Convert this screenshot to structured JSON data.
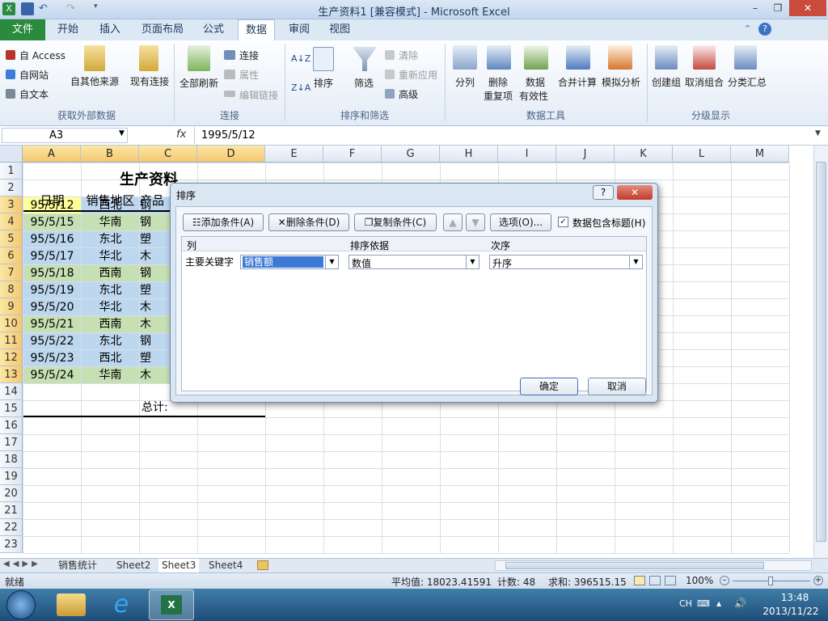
{
  "window": {
    "title": "生产资料1  [兼容模式] - Microsoft Excel",
    "minimize": "–",
    "restore": "❐",
    "close": "✕"
  },
  "tabs": [
    {
      "label": "文件"
    },
    {
      "label": "开始"
    },
    {
      "label": "插入"
    },
    {
      "label": "页面布局"
    },
    {
      "label": "公式"
    },
    {
      "label": "数据"
    },
    {
      "label": "审阅"
    },
    {
      "label": "视图"
    }
  ],
  "ribbon": {
    "ext": {
      "access": "自 Access",
      "web": "自网站",
      "text": "自文本",
      "other": "自其他来源",
      "existing": "现有连接",
      "group": "获取外部数据"
    },
    "conn": {
      "refresh_all": "全部刷新",
      "connections": "连接",
      "properties": "属性",
      "edit_links": "编辑链接",
      "group": "连接"
    },
    "sort": {
      "sort": "排序",
      "filter": "筛选",
      "clear": "清除",
      "reapply": "重新应用",
      "advanced": "高级",
      "group": "排序和筛选"
    },
    "tools": {
      "text_to_cols": "分列",
      "remove_dup_1": "删除",
      "remove_dup_2": "重复项",
      "validation_1": "数据",
      "validation_2": "有效性",
      "consolidate": "合并计算",
      "whatif": "模拟分析",
      "group": "数据工具"
    },
    "outline": {
      "group_btn": "创建组",
      "ungroup": "取消组合",
      "subtotal": "分类汇总",
      "group": "分级显示"
    }
  },
  "formula_bar": {
    "name_box": "A3",
    "fx": "fx",
    "value": "1995/5/12"
  },
  "columns": [
    "A",
    "B",
    "C",
    "D",
    "E",
    "F",
    "G",
    "H",
    "I",
    "J",
    "K",
    "L",
    "M"
  ],
  "rows": [
    "1",
    "2",
    "3",
    "4",
    "5",
    "6",
    "7",
    "8",
    "9",
    "10",
    "11",
    "12",
    "13",
    "14",
    "15",
    "16",
    "17",
    "18",
    "19",
    "20",
    "21",
    "22",
    "23"
  ],
  "sheet": {
    "title": "生产资料",
    "headers": [
      "日期",
      "销售地区",
      "产品"
    ],
    "data": [
      {
        "date": "95/5/12",
        "region": "西北",
        "product": "钢"
      },
      {
        "date": "95/5/15",
        "region": "华南",
        "product": "钢"
      },
      {
        "date": "95/5/16",
        "region": "东北",
        "product": "塑"
      },
      {
        "date": "95/5/17",
        "region": "华北",
        "product": "木"
      },
      {
        "date": "95/5/18",
        "region": "西南",
        "product": "钢"
      },
      {
        "date": "95/5/19",
        "region": "东北",
        "product": "塑"
      },
      {
        "date": "95/5/20",
        "region": "华北",
        "product": "木"
      },
      {
        "date": "95/5/21",
        "region": "西南",
        "product": "木"
      },
      {
        "date": "95/5/22",
        "region": "东北",
        "product": "钢"
      },
      {
        "date": "95/5/23",
        "region": "西北",
        "product": "塑"
      },
      {
        "date": "95/5/24",
        "region": "华南",
        "product": "木"
      }
    ],
    "total_label": "总计:"
  },
  "dialog": {
    "title": "排序",
    "help": "?",
    "add": "添加条件(A)",
    "delete": "删除条件(D)",
    "copy": "复制条件(C)",
    "options": "选项(O)...",
    "has_header": "数据包含标题(H)",
    "col_header": "列",
    "sort_on_header": "排序依据",
    "order_header": "次序",
    "row_label": "主要关键字",
    "key_value": "销售额",
    "sort_on_value": "数值",
    "order_value": "升序",
    "ok": "确定",
    "cancel": "取消"
  },
  "sheet_tabs": [
    "销售统计",
    "Sheet2",
    "Sheet3",
    "Sheet4"
  ],
  "status": {
    "ready": "就绪",
    "average": "平均值: 18023.41591",
    "count": "计数: 48",
    "sum": "求和: 396515.15",
    "zoom": "100%"
  },
  "taskbar": {
    "lang": "CH",
    "time": "13:48",
    "date": "2013/11/22"
  },
  "colors": {
    "yellow": "#ffff99",
    "green": "#c6e0b4",
    "blue": "#bdd7ee",
    "file_tab": "#2a8a3e"
  }
}
